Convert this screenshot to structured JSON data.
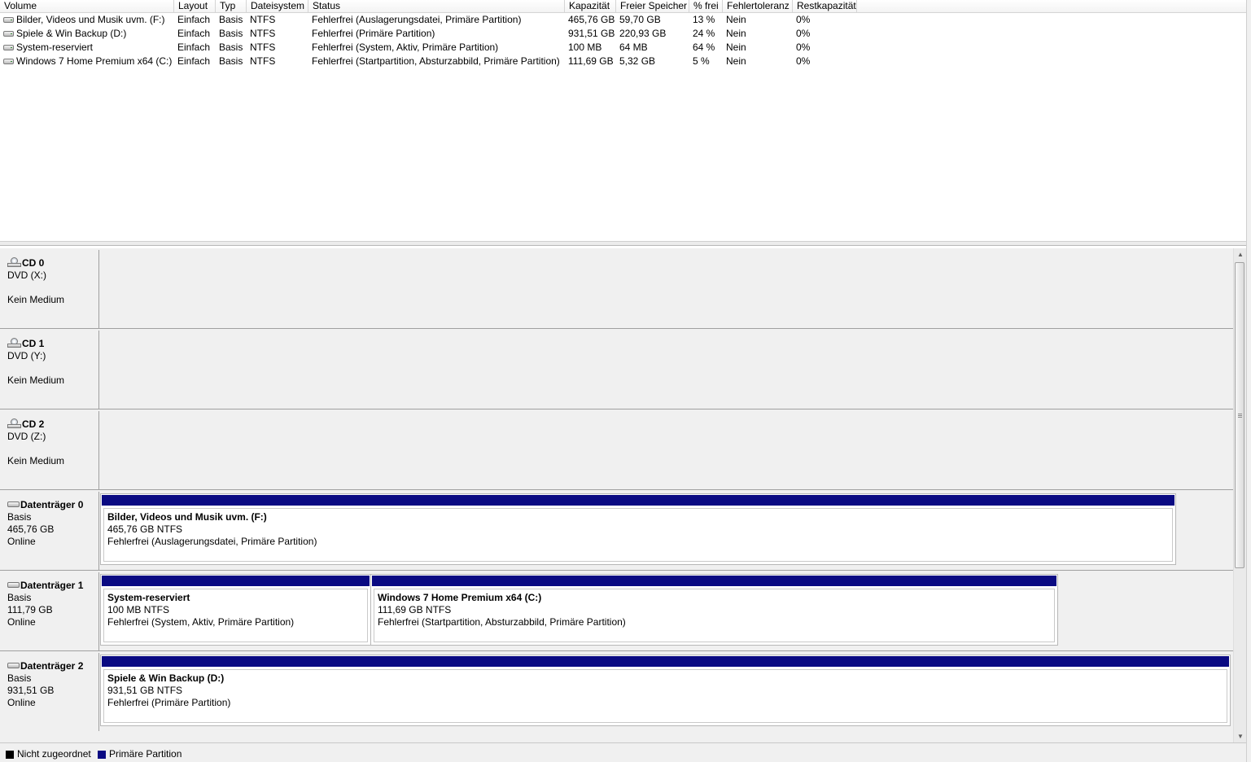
{
  "volume_list": {
    "columns": [
      "Volume",
      "Layout",
      "Typ",
      "Dateisystem",
      "Status",
      "Kapazität",
      "Freier Speicher",
      "% frei",
      "Fehlertoleranz",
      "Restkapazität"
    ],
    "rows": [
      {
        "volume": "Bilder, Videos und Musik uvm. (F:)",
        "layout": "Einfach",
        "typ": "Basis",
        "fs": "NTFS",
        "status": "Fehlerfrei (Auslagerungsdatei, Primäre Partition)",
        "kapazitaet": "465,76 GB",
        "frei": "59,70 GB",
        "prozent": "13 %",
        "fehlertoleranz": "Nein",
        "rest": "0%",
        "icon": "drive-icon"
      },
      {
        "volume": "Spiele & Win Backup (D:)",
        "layout": "Einfach",
        "typ": "Basis",
        "fs": "NTFS",
        "status": "Fehlerfrei (Primäre Partition)",
        "kapazitaet": "931,51 GB",
        "frei": "220,93 GB",
        "prozent": "24 %",
        "fehlertoleranz": "Nein",
        "rest": "0%",
        "icon": "drive-icon"
      },
      {
        "volume": "System-reserviert",
        "layout": "Einfach",
        "typ": "Basis",
        "fs": "NTFS",
        "status": "Fehlerfrei (System, Aktiv, Primäre Partition)",
        "kapazitaet": "100 MB",
        "frei": "64 MB",
        "prozent": "64 %",
        "fehlertoleranz": "Nein",
        "rest": "0%",
        "icon": "drive-icon"
      },
      {
        "volume": "Windows 7 Home Premium x64 (C:)",
        "layout": "Einfach",
        "typ": "Basis",
        "fs": "NTFS",
        "status": "Fehlerfrei (Startpartition, Absturzabbild, Primäre Partition)",
        "kapazitaet": "111,69 GB",
        "frei": "5,32 GB",
        "prozent": "5 %",
        "fehlertoleranz": "Nein",
        "rest": "0%",
        "icon": "drive-icon"
      }
    ]
  },
  "disks": {
    "cd0": {
      "name": "CD 0",
      "type": "DVD (X:)",
      "state": "Kein Medium",
      "icon": "cd-drive-icon"
    },
    "cd1": {
      "name": "CD 1",
      "type": "DVD (Y:)",
      "state": "Kein Medium",
      "icon": "cd-drive-icon"
    },
    "cd2": {
      "name": "CD 2",
      "type": "DVD (Z:)",
      "state": "Kein Medium",
      "icon": "cd-drive-icon"
    },
    "d0": {
      "name": "Datenträger 0",
      "type": "Basis",
      "size": "465,76 GB",
      "state": "Online",
      "icon": "hard-disk-icon",
      "partitions": [
        {
          "title": "Bilder, Videos und Musik uvm.  (F:)",
          "size": "465,76 GB NTFS",
          "status": "Fehlerfrei (Auslagerungsdatei, Primäre Partition)"
        }
      ]
    },
    "d1": {
      "name": "Datenträger 1",
      "type": "Basis",
      "size": "111,79 GB",
      "state": "Online",
      "icon": "hard-disk-icon",
      "partitions": [
        {
          "title": "System-reserviert",
          "size": "100 MB NTFS",
          "status": "Fehlerfrei (System, Aktiv, Primäre Partition)"
        },
        {
          "title": "Windows 7 Home Premium x64  (C:)",
          "size": "111,69 GB NTFS",
          "status": "Fehlerfrei (Startpartition, Absturzabbild, Primäre Partition)"
        }
      ]
    },
    "d2": {
      "name": "Datenträger 2",
      "type": "Basis",
      "size": "931,51 GB",
      "state": "Online",
      "icon": "hard-disk-icon",
      "partitions": [
        {
          "title": "Spiele & Win Backup  (D:)",
          "size": "931,51 GB NTFS",
          "status": "Fehlerfrei (Primäre Partition)"
        }
      ]
    }
  },
  "legend": [
    {
      "label": "Nicht zugeordnet",
      "color": "#000000"
    },
    {
      "label": "Primäre Partition",
      "color": "#0a0a82"
    }
  ],
  "colors": {
    "primary_partition": "#0a0a82",
    "unallocated": "#000000"
  }
}
